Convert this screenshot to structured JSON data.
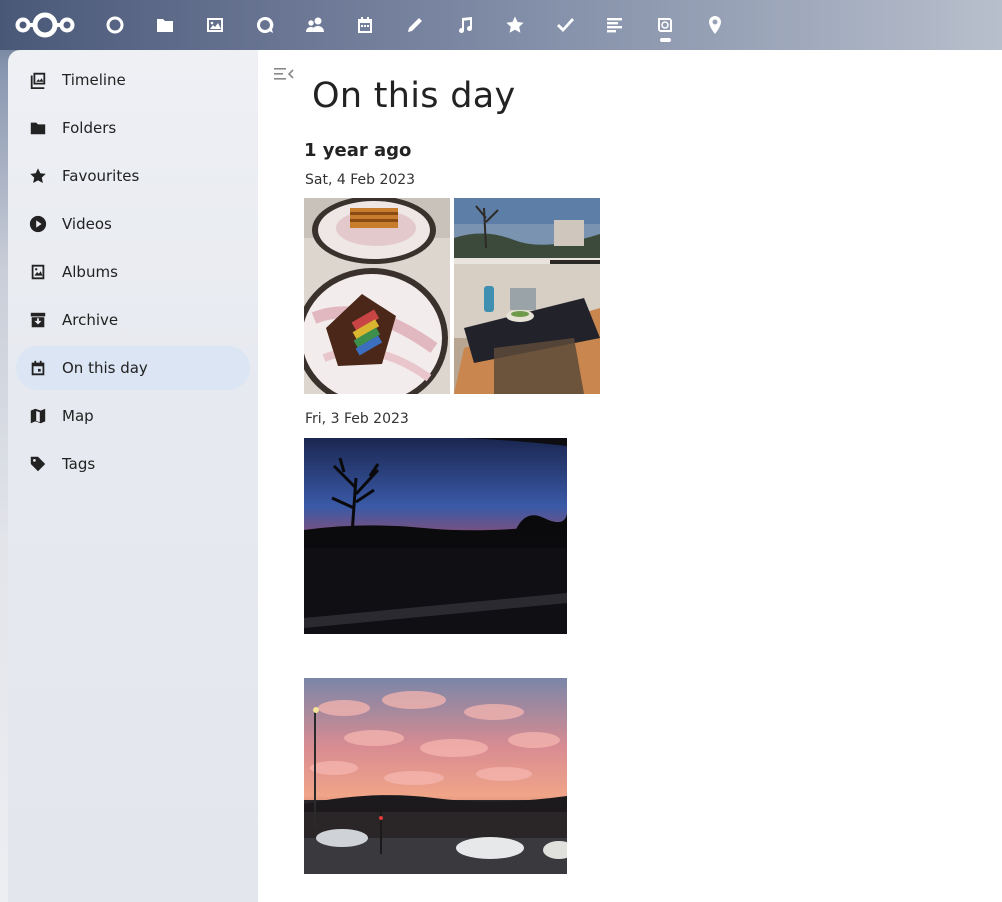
{
  "header": {
    "apps": [
      {
        "name": "dashboard-app-icon"
      },
      {
        "name": "files-app-icon"
      },
      {
        "name": "photos-app-icon"
      },
      {
        "name": "talk-app-icon"
      },
      {
        "name": "contacts-app-icon"
      },
      {
        "name": "calendar-app-icon"
      },
      {
        "name": "notes-app-icon"
      },
      {
        "name": "music-app-icon"
      },
      {
        "name": "bookmarks-app-icon"
      },
      {
        "name": "tasks-app-icon"
      },
      {
        "name": "news-app-icon"
      },
      {
        "name": "memories-app-icon"
      },
      {
        "name": "maps-app-icon"
      }
    ]
  },
  "sidebar": {
    "items": [
      {
        "label": "Timeline",
        "icon": "timeline-icon"
      },
      {
        "label": "Folders",
        "icon": "folder-icon"
      },
      {
        "label": "Favourites",
        "icon": "star-icon"
      },
      {
        "label": "Videos",
        "icon": "play-icon"
      },
      {
        "label": "Albums",
        "icon": "album-icon"
      },
      {
        "label": "Archive",
        "icon": "archive-icon"
      },
      {
        "label": "On this day",
        "icon": "calendar-icon",
        "active": true
      },
      {
        "label": "Map",
        "icon": "map-icon"
      },
      {
        "label": "Tags",
        "icon": "tag-icon"
      }
    ]
  },
  "main": {
    "title": "On this day",
    "section": "1 year ago",
    "dates": [
      "Sat, 4 Feb 2023",
      "Fri, 3 Feb 2023"
    ]
  },
  "colors": {
    "active_item_bg": "#dbe5f3",
    "text": "#222222"
  }
}
